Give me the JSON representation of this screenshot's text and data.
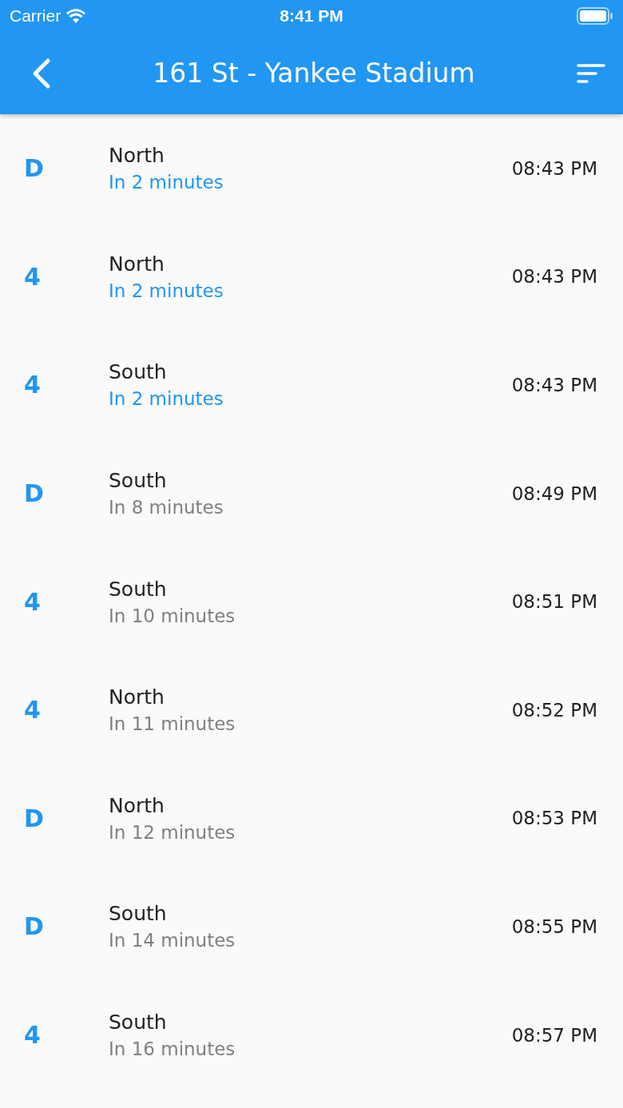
{
  "status_bar": {
    "carrier": "Carrier",
    "time": "8:41 PM"
  },
  "app_bar": {
    "title": "161 St - Yankee Stadium"
  },
  "arrivals": [
    {
      "route": "D",
      "direction": "North",
      "eta": "In 2 minutes",
      "soon": true,
      "time": "08:43 PM"
    },
    {
      "route": "4",
      "direction": "North",
      "eta": "In 2 minutes",
      "soon": true,
      "time": "08:43 PM"
    },
    {
      "route": "4",
      "direction": "South",
      "eta": "In 2 minutes",
      "soon": true,
      "time": "08:43 PM"
    },
    {
      "route": "D",
      "direction": "South",
      "eta": "In 8 minutes",
      "soon": false,
      "time": "08:49 PM"
    },
    {
      "route": "4",
      "direction": "South",
      "eta": "In 10 minutes",
      "soon": false,
      "time": "08:51 PM"
    },
    {
      "route": "4",
      "direction": "North",
      "eta": "In 11 minutes",
      "soon": false,
      "time": "08:52 PM"
    },
    {
      "route": "D",
      "direction": "North",
      "eta": "In 12 minutes",
      "soon": false,
      "time": "08:53 PM"
    },
    {
      "route": "D",
      "direction": "South",
      "eta": "In 14 minutes",
      "soon": false,
      "time": "08:55 PM"
    },
    {
      "route": "4",
      "direction": "South",
      "eta": "In 16 minutes",
      "soon": false,
      "time": "08:57 PM"
    }
  ]
}
